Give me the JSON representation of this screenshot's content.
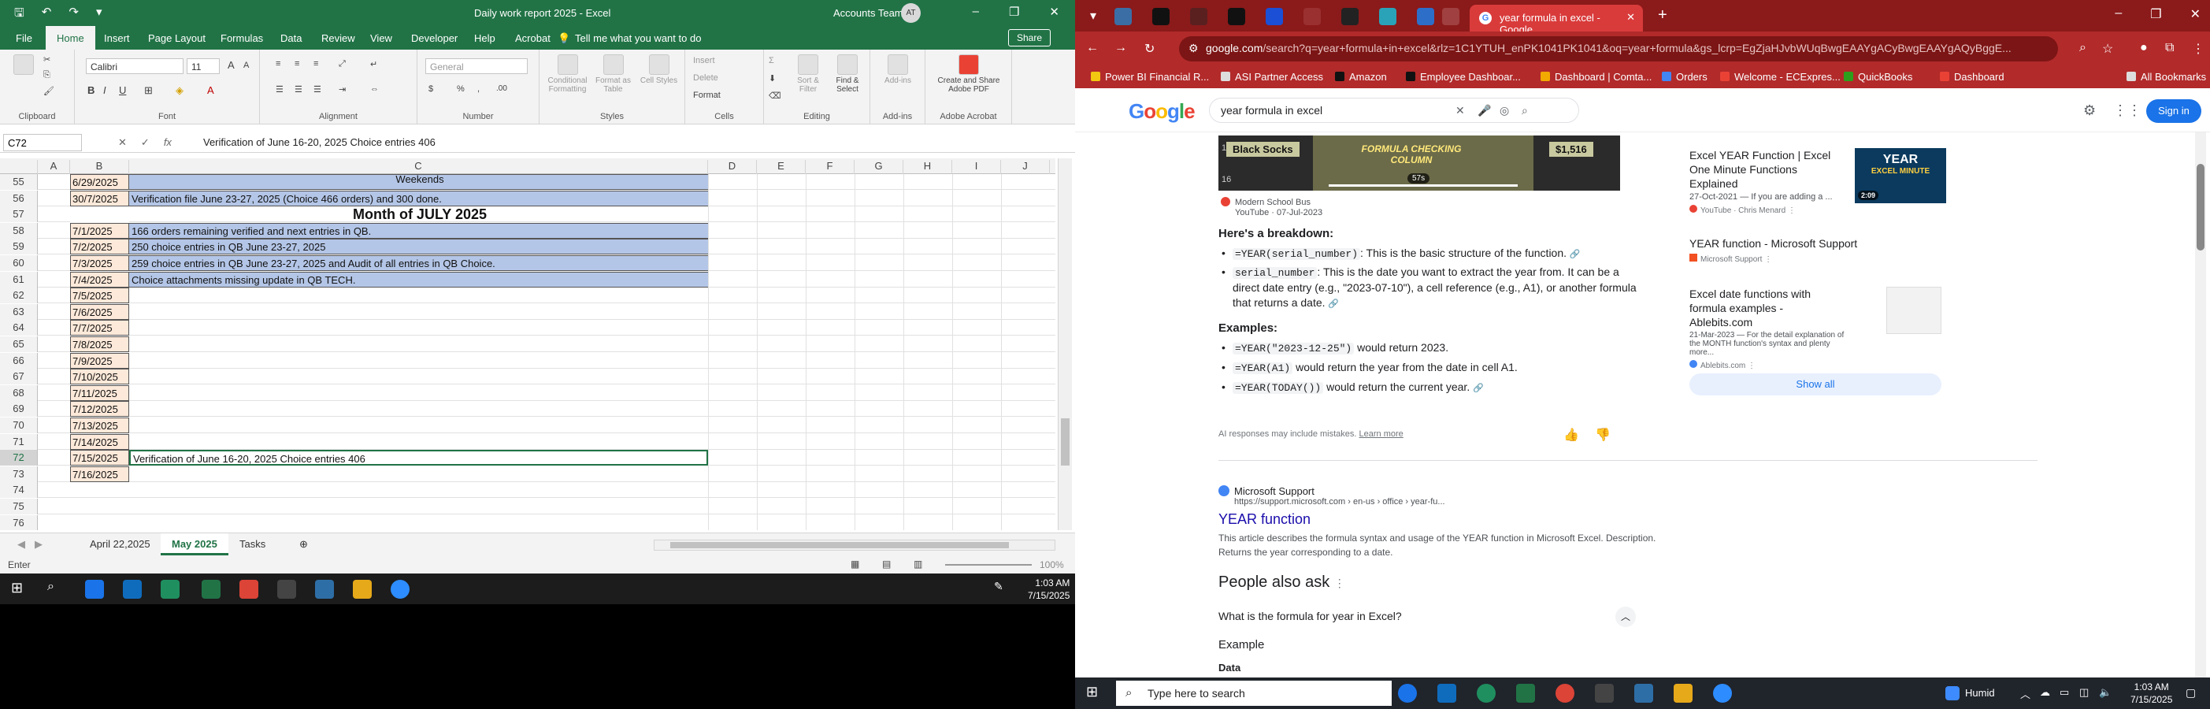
{
  "excel": {
    "title": "Daily work report 2025  -  Excel",
    "account": "Accounts Team",
    "avatar_initials": "AT",
    "tabs": [
      "File",
      "Home",
      "Insert",
      "Page Layout",
      "Formulas",
      "Data",
      "Review",
      "View",
      "Developer",
      "Help",
      "Acrobat"
    ],
    "tell_me": "Tell me what you want to do",
    "share": "Share",
    "ribbon": {
      "font_name": "Calibri",
      "font_size": "11",
      "number_format": "General",
      "groups": [
        "Clipboard",
        "Font",
        "Alignment",
        "Number",
        "Styles",
        "Cells",
        "Editing",
        "Add-ins",
        "Adobe Acrobat"
      ],
      "paste": "Paste",
      "styles_buttons": [
        "Conditional Formatting",
        "Format as Table",
        "Cell Styles"
      ],
      "cells_buttons": [
        "Insert",
        "Delete",
        "Format"
      ],
      "editing_buttons": [
        "Sort & Filter",
        "Find & Select"
      ],
      "addins": "Add-ins",
      "acrobat": "Create and Share Adobe PDF"
    },
    "name_box": "C72",
    "formula": "Verification of June 16-20, 2025 Choice entries 406",
    "columns": [
      "A",
      "B",
      "C",
      "D",
      "E",
      "F",
      "G",
      "H",
      "I",
      "J"
    ],
    "rows": [
      {
        "n": "55",
        "b": "6/29/2025",
        "c": "Weekends",
        "style": "hl"
      },
      {
        "n": "56",
        "b": "30/7/2025",
        "c": "Verification file June 23-27, 2025 (Choice 466 orders) and 300 done.",
        "style": "hl"
      },
      {
        "n": "57",
        "b": "",
        "c": "Month of JULY 2025",
        "style": "month"
      },
      {
        "n": "58",
        "b": "7/1/2025",
        "c": "166 orders remaining verified and next entries in QB.",
        "style": "hl"
      },
      {
        "n": "59",
        "b": "7/2/2025",
        "c": "250 choice entries in QB June 23-27, 2025",
        "style": "hl"
      },
      {
        "n": "60",
        "b": "7/3/2025",
        "c": "259 choice entries in QB June 23-27, 2025 and Audit of all entries in QB Choice.",
        "style": "hl"
      },
      {
        "n": "61",
        "b": "7/4/2025",
        "c": "Choice attachments missing update in QB TECH.",
        "style": "hl"
      },
      {
        "n": "62",
        "b": "7/5/2025",
        "c": "",
        "style": ""
      },
      {
        "n": "63",
        "b": "7/6/2025",
        "c": "",
        "style": ""
      },
      {
        "n": "64",
        "b": "7/7/2025",
        "c": "",
        "style": ""
      },
      {
        "n": "65",
        "b": "7/8/2025",
        "c": "",
        "style": ""
      },
      {
        "n": "66",
        "b": "7/9/2025",
        "c": "",
        "style": ""
      },
      {
        "n": "67",
        "b": "7/10/2025",
        "c": "",
        "style": ""
      },
      {
        "n": "68",
        "b": "7/11/2025",
        "c": "",
        "style": ""
      },
      {
        "n": "69",
        "b": "7/12/2025",
        "c": "",
        "style": ""
      },
      {
        "n": "70",
        "b": "7/13/2025",
        "c": "",
        "style": ""
      },
      {
        "n": "71",
        "b": "7/14/2025",
        "c": "",
        "style": ""
      },
      {
        "n": "72",
        "b": "7/15/2025",
        "c": "Verification of June 16-20, 2025 Choice entries 406",
        "style": "active"
      },
      {
        "n": "73",
        "b": "7/16/2025",
        "c": "",
        "style": ""
      },
      {
        "n": "74",
        "b": "",
        "c": "",
        "style": ""
      },
      {
        "n": "75",
        "b": "",
        "c": "",
        "style": ""
      },
      {
        "n": "76",
        "b": "",
        "c": "",
        "style": ""
      }
    ],
    "sheets": [
      "April 22,2025",
      "May 2025",
      "Tasks"
    ],
    "active_sheet": "May 2025",
    "status_mode": "Enter",
    "zoom": "100%",
    "clock_time": "1:03 AM",
    "clock_date": "7/15/2025"
  },
  "chrome": {
    "active_tab": "year formula in excel - Google",
    "url_main": "google.com",
    "url_rest": "/search?q=year+formula+in+excel&rlz=1C1YTUH_enPK1041PK1041&oq=year+formula&gs_lcrp=EgZjaHJvbWUqBwgEAAYgACyBwgEAAYgAQyBggE...",
    "bookmarks": [
      "Power BI Financial R...",
      "ASI Partner Access",
      "Amazon",
      "Employee Dashboar...",
      "Dashboard | Comta...",
      "Orders",
      "Welcome - ECExpres...",
      "QuickBooks",
      "Dashboard"
    ],
    "all_bookmarks": "All Bookmarks",
    "search_query": "year formula in excel",
    "sign_in": "Sign in",
    "video_thumb": {
      "left": "Black Socks",
      "middle": "FORMULA CHECKING COLUMN",
      "right": "$1,516",
      "duration": "57s",
      "n1": "15",
      "n2": "16"
    },
    "video_source": "Modern School Bus",
    "video_meta": "YouTube · 07-Jul-2023",
    "breakdown_title": "Here's a breakdown:",
    "bullets": [
      {
        "code": "=YEAR(serial_number)",
        "text": ": This is the basic structure of the function."
      },
      {
        "code": "serial_number",
        "text": ": This is the date you want to extract the year from. It can be a direct date entry (e.g., \"2023-07-10\"), a cell reference (e.g., A1), or another formula that returns a date."
      }
    ],
    "examples_title": "Examples:",
    "examples": [
      {
        "code": "=YEAR(\"2023-12-25\")",
        "text": " would return 2023."
      },
      {
        "code": "=YEAR(A1)",
        "text": " would return the year from the date in cell A1."
      },
      {
        "code": "=YEAR(TODAY())",
        "text": " would return the current year."
      }
    ],
    "ai_note": "AI responses may include mistakes.",
    "learn_more": "Learn more",
    "side_cards": [
      {
        "title": "Excel YEAR Function | Excel One Minute Functions Explained",
        "meta": "27-Oct-2021 — If you are adding a ...",
        "who": "YouTube · Chris Menard"
      },
      {
        "title": "YEAR function - Microsoft Support",
        "meta": "",
        "who": "Microsoft Support"
      },
      {
        "title": "Excel date functions with formula examples - Ablebits.com",
        "meta": "21-Mar-2023 — For the detail explanation of the MONTH function's syntax and plenty more...",
        "who": "Ablebits.com"
      }
    ],
    "yt_thumb": {
      "main": "YEAR",
      "sub": "EXCEL MINUTE",
      "dur": "2:09"
    },
    "show_all": "Show all",
    "ms_name": "Microsoft Support",
    "ms_url": "https://support.microsoft.com › en-us › office › year-fu...",
    "ms_title": "YEAR function",
    "ms_desc": "This article describes the formula syntax and usage of the YEAR function in Microsoft Excel. Description. Returns the year corresponding to a date.",
    "paa_title": "People also ask",
    "paa_question": "What is the formula for year in Excel?",
    "paa_example": "Example",
    "paa_data": "Data"
  },
  "taskbar2": {
    "search_placeholder": "Type here to search",
    "weather": "Humid",
    "clock_time": "1:03 AM",
    "clock_date": "7/15/2025"
  }
}
